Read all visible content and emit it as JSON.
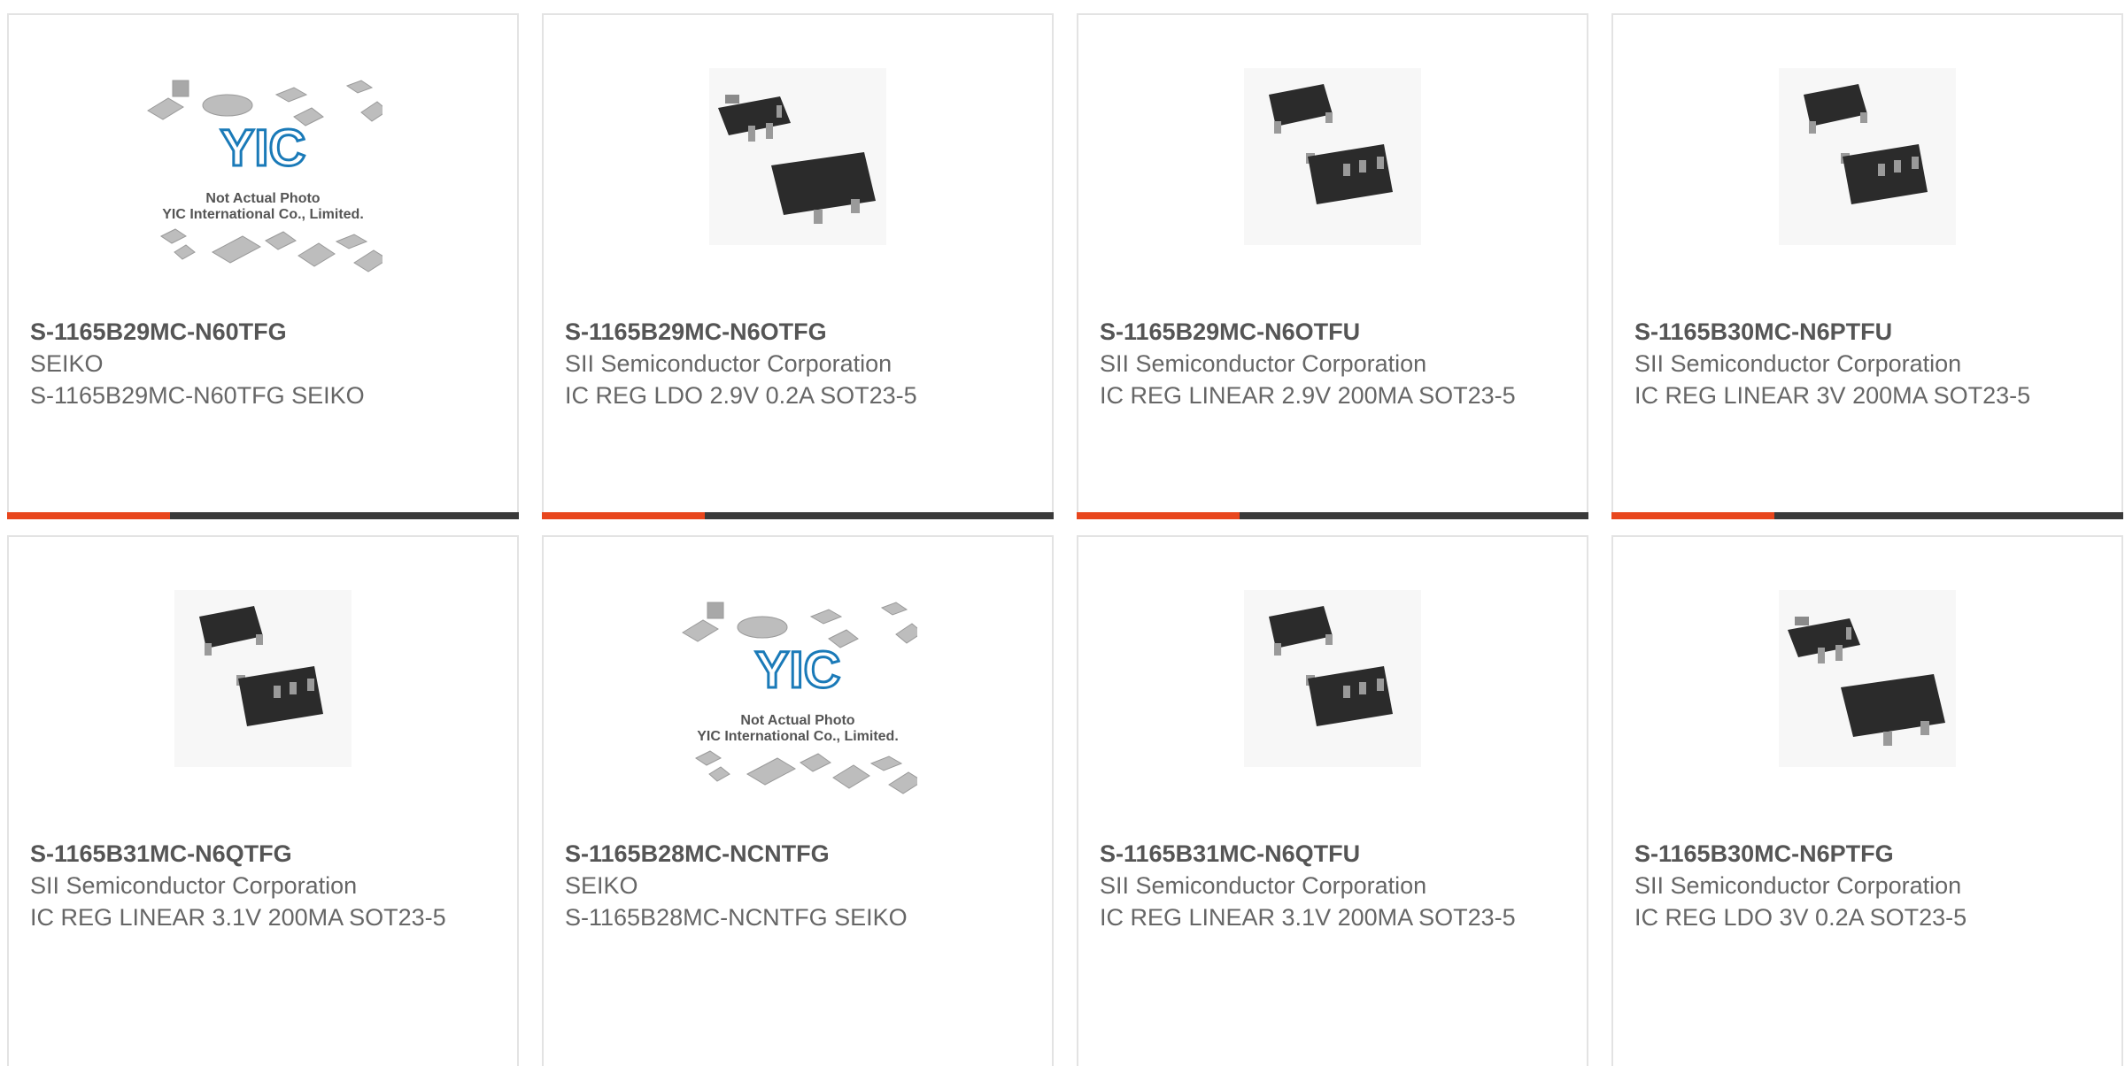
{
  "colors": {
    "accent": "#e8461d",
    "bar_dark": "#3a3a3a",
    "card_border": "#e3e3e3",
    "title_text": "#555555",
    "body_text": "#666666"
  },
  "products": [
    {
      "part": "S-1165B29MC-N60TFG",
      "manufacturer": "SEIKO",
      "description": "S-1165B29MC-N60TFG SEIKO",
      "image": "placeholder",
      "image_caption_1": "Not Actual Photo",
      "image_caption_2": "YIC International Co., Limited.",
      "image_logo": "YIC"
    },
    {
      "part": "S-1165B29MC-N6OTFG",
      "manufacturer": "SII Semiconductor Corporation",
      "description": "IC REG LDO 2.9V 0.2A SOT23-5",
      "image": "sot23-style-a"
    },
    {
      "part": "S-1165B29MC-N6OTFU",
      "manufacturer": "SII Semiconductor Corporation",
      "description": "IC REG LINEAR 2.9V 200MA SOT23-5",
      "image": "sot23-style-b"
    },
    {
      "part": "S-1165B30MC-N6PTFU",
      "manufacturer": "SII Semiconductor Corporation",
      "description": "IC REG LINEAR 3V 200MA SOT23-5",
      "image": "sot23-style-b"
    },
    {
      "part": "S-1165B31MC-N6QTFG",
      "manufacturer": "SII Semiconductor Corporation",
      "description": "IC REG LINEAR 3.1V 200MA SOT23-5",
      "image": "sot23-style-b"
    },
    {
      "part": "S-1165B28MC-NCNTFG",
      "manufacturer": "SEIKO",
      "description": "S-1165B28MC-NCNTFG SEIKO",
      "image": "placeholder",
      "image_caption_1": "Not Actual Photo",
      "image_caption_2": "YIC International Co., Limited.",
      "image_logo": "YIC"
    },
    {
      "part": "S-1165B31MC-N6QTFU",
      "manufacturer": "SII Semiconductor Corporation",
      "description": "IC REG LINEAR 3.1V 200MA SOT23-5",
      "image": "sot23-style-b"
    },
    {
      "part": "S-1165B30MC-N6PTFG",
      "manufacturer": "SII Semiconductor Corporation",
      "description": "IC REG LDO 3V 0.2A SOT23-5",
      "image": "sot23-style-a"
    }
  ]
}
